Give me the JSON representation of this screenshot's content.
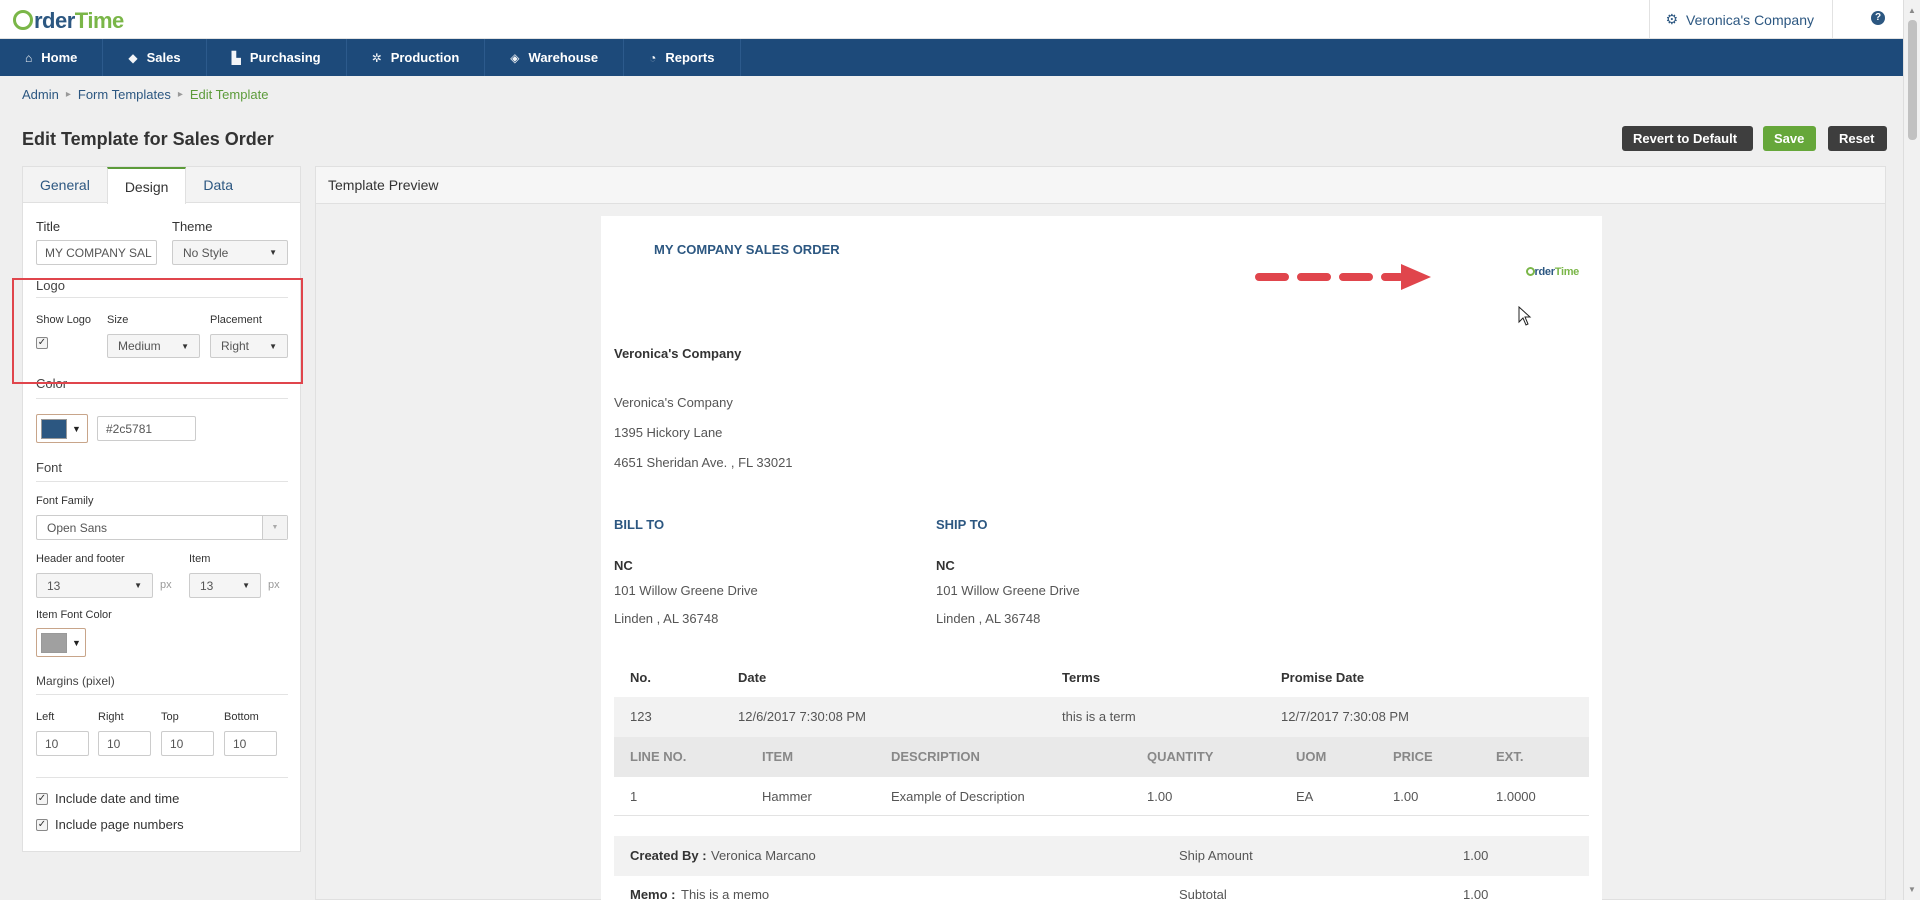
{
  "app": {
    "logo_prefix": "rder",
    "logo_suffix": "Time",
    "company": "Veronica's Company",
    "help": "?"
  },
  "nav": [
    {
      "label": "Home",
      "icon": "home-icon"
    },
    {
      "label": "Sales",
      "icon": "tag-icon"
    },
    {
      "label": "Purchasing",
      "icon": "cart-icon"
    },
    {
      "label": "Production",
      "icon": "gears-icon"
    },
    {
      "label": "Warehouse",
      "icon": "box-icon"
    },
    {
      "label": "Reports",
      "icon": "pie-chart-icon"
    }
  ],
  "breadcrumb": {
    "admin": "Admin",
    "form_templates": "Form Templates",
    "current": "Edit Template"
  },
  "page_title": "Edit Template for Sales Order",
  "actions": {
    "revert": "Revert to Default",
    "save": "Save",
    "reset": "Reset"
  },
  "left": {
    "tabs": [
      "General",
      "Design",
      "Data"
    ],
    "title_label": "Title",
    "title_value": "MY COMPANY SAL",
    "theme_label": "Theme",
    "theme_value": "No Style",
    "logo_section": "Logo",
    "show_logo_label": "Show Logo",
    "show_logo_checked": true,
    "size_label": "Size",
    "size_value": "Medium",
    "placement_label": "Placement",
    "placement_value": "Right",
    "color_section": "Color",
    "color_hex": "#2c5781",
    "font_section": "Font",
    "font_family_label": "Font Family",
    "font_family_value": "Open Sans",
    "header_footer_label": "Header and footer",
    "header_footer_value": "13",
    "item_label": "Item",
    "item_value": "13",
    "px_unit": "px",
    "item_font_color_label": "Item Font Color",
    "item_font_color": "#a0a0a0",
    "margins_label": "Margins (pixel)",
    "margins": [
      {
        "label": "Left",
        "value": "10"
      },
      {
        "label": "Right",
        "value": "10"
      },
      {
        "label": "Top",
        "value": "10"
      },
      {
        "label": "Bottom",
        "value": "10"
      }
    ],
    "include_date": "Include date and time",
    "include_pages": "Include page numbers"
  },
  "preview": {
    "header": "Template Preview",
    "doc_title": "MY COMPANY SALES ORDER",
    "logo_prefix": "rder",
    "logo_suffix": "Time",
    "company_name": "Veronica's Company",
    "address": [
      "Veronica's Company",
      "1395 Hickory Lane",
      "4651 Sheridan Ave. , FL 33021"
    ],
    "bill_to": {
      "heading": "BILL TO",
      "name": "NC",
      "line1": "101 Willow Greene Drive",
      "line2": "Linden , AL 36748"
    },
    "ship_to": {
      "heading": "SHIP TO",
      "name": "NC",
      "line1": "101 Willow Greene Drive",
      "line2": "Linden , AL 36748"
    },
    "order_headers": [
      "No.",
      "Date",
      "Terms",
      "Promise Date"
    ],
    "order_values": [
      "123",
      "12/6/2017 7:30:08 PM",
      "this is a term",
      "12/7/2017 7:30:08 PM"
    ],
    "line_headers": [
      "LINE NO.",
      "ITEM",
      "DESCRIPTION",
      "QUANTITY",
      "UOM",
      "PRICE",
      "EXT."
    ],
    "line_values": [
      "1",
      "Hammer",
      "Example of Description",
      "1.00",
      "EA",
      "1.00",
      "1.0000"
    ],
    "created_by_label": "Created By :",
    "created_by": "Veronica Marcano",
    "memo_label": "Memo :",
    "memo": "This is a memo",
    "ship_amount_label": "Ship Amount",
    "ship_amount": "1.00",
    "subtotal_label": "Subtotal",
    "subtotal": "1.00"
  },
  "colors": {
    "nav": "#1d4a7a",
    "accent_green": "#66a73a",
    "brand_blue": "#2c5781",
    "annotation_red": "#e0454c"
  }
}
